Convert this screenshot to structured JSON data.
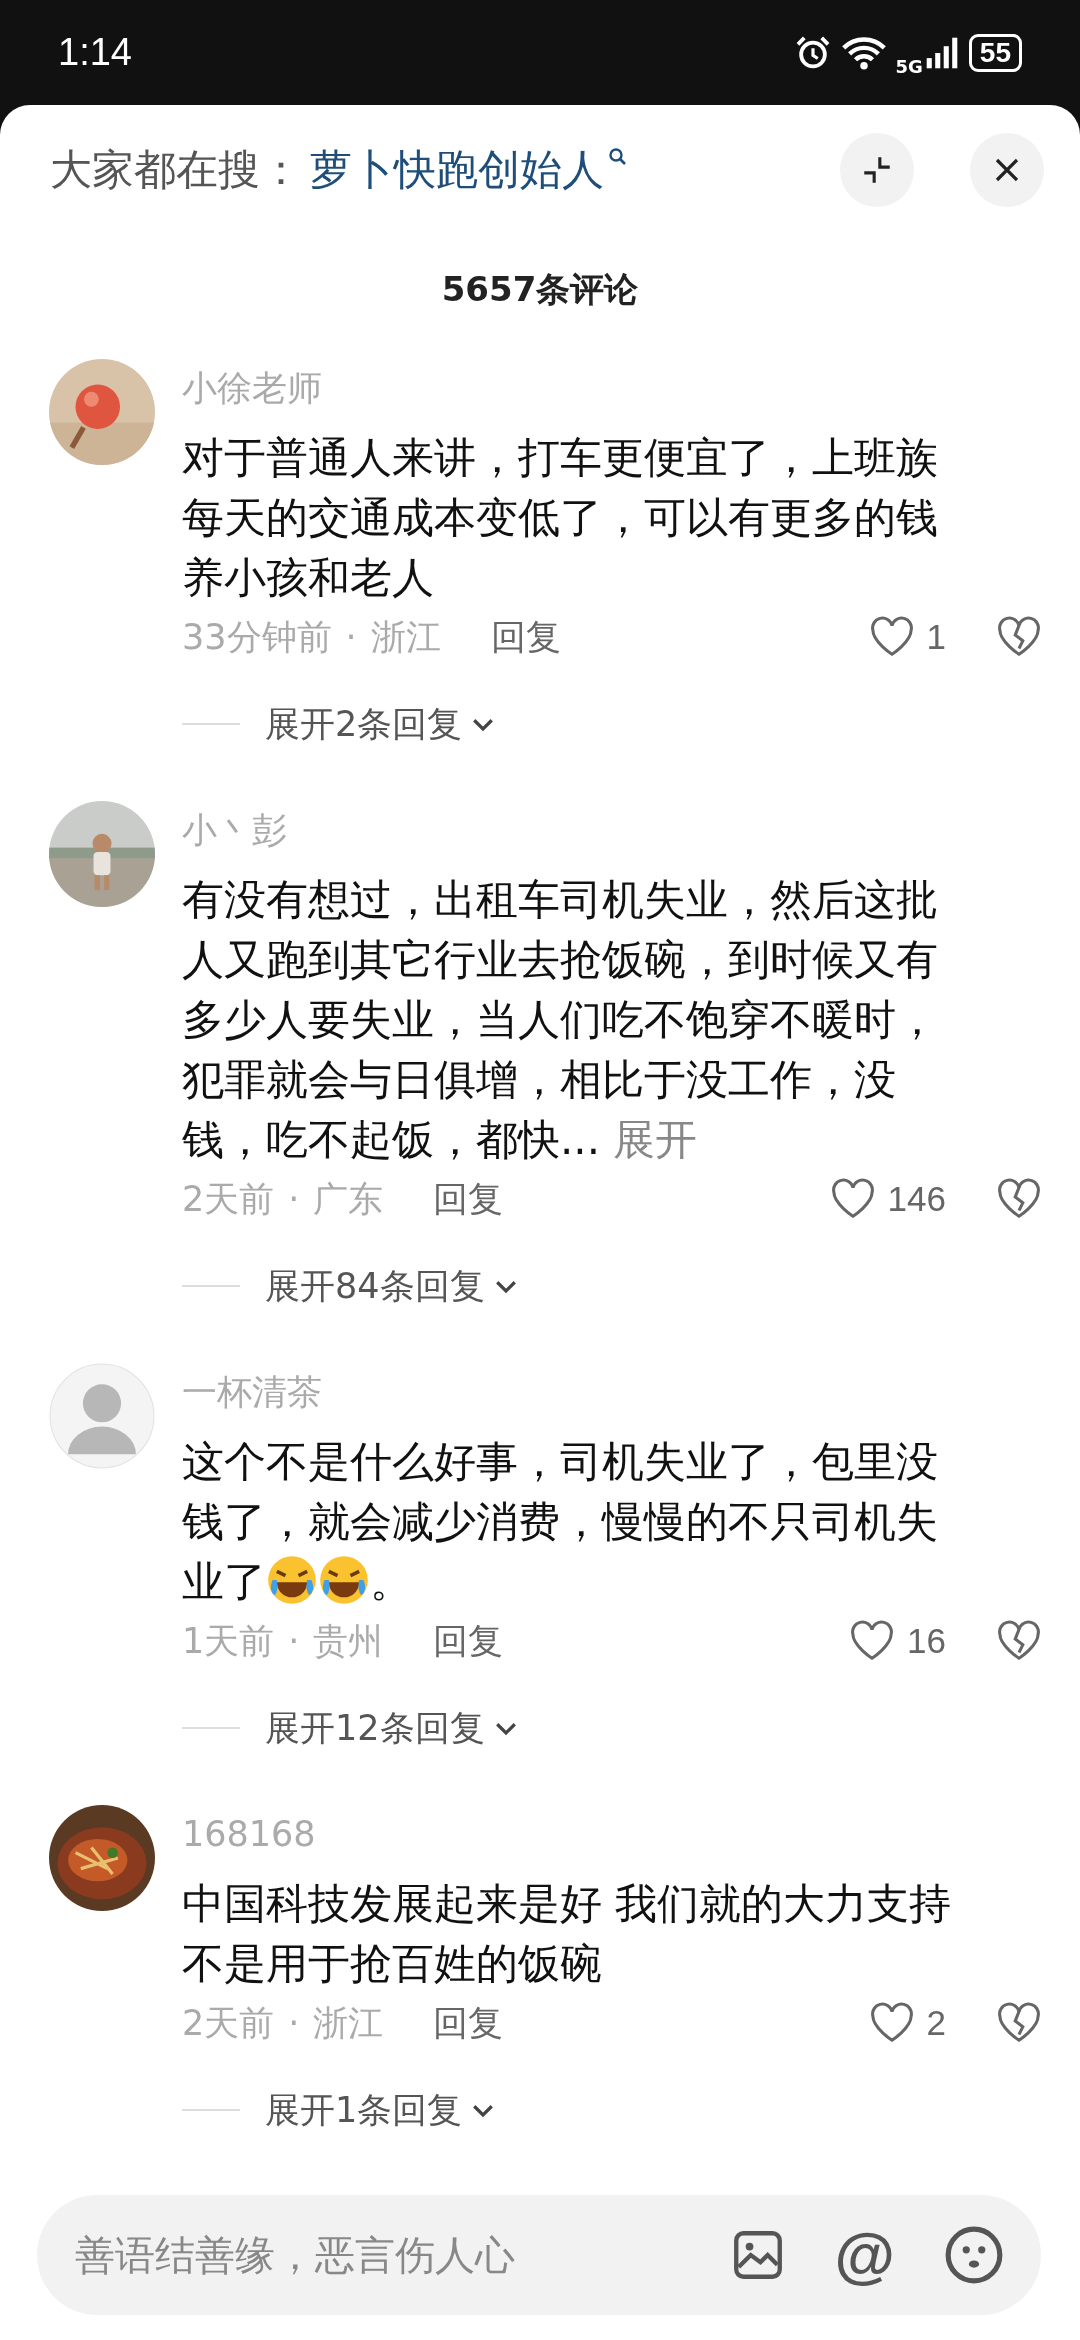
{
  "status_bar": {
    "time": "1:14",
    "network": "5G",
    "battery": "55"
  },
  "search_bar": {
    "label": "大家都在搜：",
    "query": "萝卜快跑创始人"
  },
  "comments_title": "5657条评论",
  "comments": [
    {
      "avatar": {
        "kind": "picture"
      },
      "user": "小徐老师",
      "body": [
        {
          "kind": "text",
          "text": "对于普通人来讲，打车更便宜了，上班族每天的交通成本变低了，可以有更多的钱养小孩和老人"
        }
      ],
      "time": "33分钟前",
      "separator": "·",
      "location": "浙江",
      "reply": "回复",
      "likes": "1",
      "expand": "展开2条回复"
    },
    {
      "avatar": {
        "kind": "picture"
      },
      "user": "小丶彭",
      "body": [
        {
          "kind": "text",
          "text": "有没有想过，出租车司机失业，然后这批人又跑到其它行业去抢饭碗，到时候又有多少人要失业，当人们吃不饱穿不暖时，犯罪就会与日俱增，相比于没工作，没钱，吃不起饭，都快... "
        },
        {
          "kind": "link",
          "text": "展开"
        }
      ],
      "time": "2天前",
      "separator": "·",
      "location": "广东",
      "reply": "回复",
      "likes": "146",
      "expand": "展开84条回复"
    },
    {
      "avatar": {
        "kind": "avatar"
      },
      "user": "一杯清茶",
      "body": [
        {
          "kind": "text",
          "text": "这个不是什么好事，司机失业了，包里没钱了，就会减少消费，慢慢的不只司机失业了"
        },
        {
          "kind": "emoji"
        },
        {
          "kind": "emoji"
        },
        {
          "kind": "text",
          "text": "。"
        }
      ],
      "time": "1天前",
      "separator": "·",
      "location": "贵州",
      "reply": "回复",
      "likes": "16",
      "expand": "展开12条回复"
    },
    {
      "avatar": {
        "kind": "picture"
      },
      "user": "168168",
      "body": [
        {
          "kind": "text",
          "text": "中国科技发展起来是好 我们就的大力支持不是用于抢百姓的饭碗"
        }
      ],
      "time": "2天前",
      "separator": "·",
      "location": "浙江",
      "reply": "回复",
      "likes": "2",
      "expand": "展开1条回复"
    }
  ],
  "input": {
    "placeholder": "善语结善缘，恶言伤人心",
    "mention": "@"
  }
}
